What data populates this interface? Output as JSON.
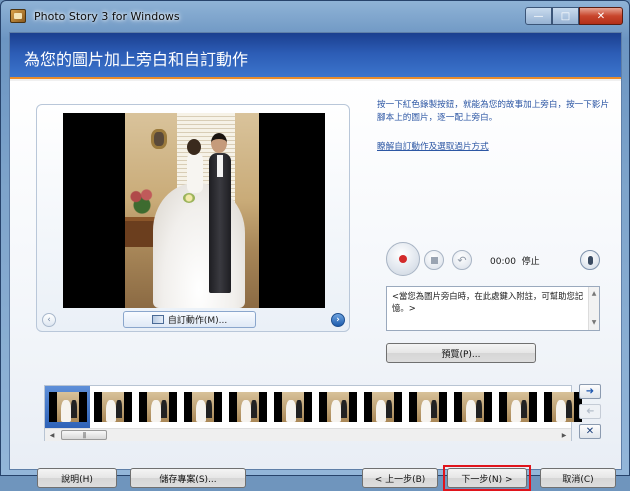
{
  "window": {
    "title": "Photo Story 3 for Windows",
    "minimize_label": "—",
    "maximize_label": "□",
    "close_label": "✕"
  },
  "banner": {
    "title": "為您的圖片加上旁白和自訂動作"
  },
  "instructions": {
    "text": "按一下紅色錄製按鈕，就能為您的故事加上旁白，按一下影片腳本上的圖片，逐一配上旁白。",
    "learn_link": "瞭解自訂動作及選取過片方式"
  },
  "preview": {
    "custom_motion_label": "自訂動作(M)...",
    "prev_label": "‹",
    "next_label": "›"
  },
  "recorder": {
    "time": "00:00",
    "status": "停止",
    "undo_label": "↶"
  },
  "note": {
    "text": "<當您為圖片旁白時，在此處鍵入附註，可幫助您記憶。>"
  },
  "buttons": {
    "preview": "預覽(P)...",
    "help": "說明(H)",
    "save_project": "儲存專案(S)...",
    "back": "< 上一步(B)",
    "next": "下一步(N) >",
    "cancel": "取消(C)"
  },
  "filmstrip": {
    "thumbnail_count": 12,
    "selected_index": 0
  },
  "colors": {
    "banner": "#2c5cb5",
    "accent_line": "#e98c2a",
    "link": "#2d57a4",
    "highlight_box": "#e0141c"
  }
}
